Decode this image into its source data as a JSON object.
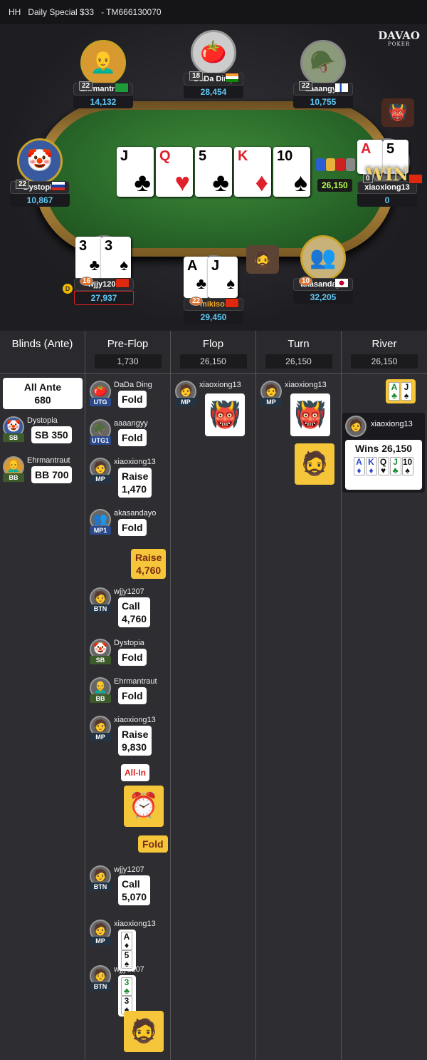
{
  "header": {
    "mode": "HH",
    "tournament": "Daily Special $33",
    "id": "- TM666130070"
  },
  "logo": {
    "name": "DAVAO",
    "sub": "POKER"
  },
  "seats": [
    {
      "key": "ehrmantraut",
      "name": "Ehrmantraut",
      "stack": "14,132",
      "level": "22",
      "flag": "brazil"
    },
    {
      "key": "dada",
      "name": "DaDa Ding",
      "stack": "28,454",
      "level": "18",
      "flag": "india"
    },
    {
      "key": "aaaangyy",
      "name": "aaaangyy",
      "stack": "10,755",
      "level": "22",
      "flag": "finland"
    },
    {
      "key": "dystopia",
      "name": "Dystopia",
      "stack": "10,867",
      "level": "22",
      "flag": "russia"
    },
    {
      "key": "xiaoxiong",
      "name": "xiaoxiong13",
      "stack": "0",
      "level": "0",
      "flag": "china"
    },
    {
      "key": "wjjy",
      "name": "wjjy1207",
      "stack": "27,937",
      "level": "16",
      "flag": "china"
    },
    {
      "key": "mikisol",
      "name": "mikisol",
      "stack": "29,450",
      "level": "22",
      "flag": "hongkong"
    },
    {
      "key": "akasandayo",
      "name": "akasandayo",
      "stack": "32,205",
      "level": "10",
      "flag": "japan"
    }
  ],
  "board": [
    {
      "rank": "J",
      "suit": "♣",
      "color": "black"
    },
    {
      "rank": "Q",
      "suit": "♥",
      "color": "red"
    },
    {
      "rank": "5",
      "suit": "♣",
      "color": "black"
    },
    {
      "rank": "K",
      "suit": "♦",
      "color": "red"
    },
    {
      "rank": "10",
      "suit": "♠",
      "color": "black"
    }
  ],
  "pot": "26,150",
  "win_label": "WIN",
  "dealer_button": "D",
  "hole_cards": {
    "xiaoxiong": [
      {
        "rank": "A",
        "suit": "♠"
      },
      {
        "rank": "5",
        "suit": "♠"
      }
    ],
    "wjjy": [
      {
        "rank": "3",
        "suit": "♣"
      },
      {
        "rank": "3",
        "suit": "♠"
      }
    ],
    "mikisol": [
      {
        "rank": "A",
        "suit": "♣"
      },
      {
        "rank": "J",
        "suit": "♠"
      }
    ]
  },
  "columns": [
    {
      "title": "Blinds (Ante)",
      "pot": ""
    },
    {
      "title": "Pre-Flop",
      "pot": "1,730"
    },
    {
      "title": "Flop",
      "pot": "26,150"
    },
    {
      "title": "Turn",
      "pot": "26,150"
    },
    {
      "title": "River",
      "pot": "26,150"
    }
  ],
  "blinds": {
    "ante_label": "All Ante",
    "ante_value": "680",
    "sb": {
      "name": "Dystopia",
      "pos": "SB",
      "action": "SB",
      "amount": "350"
    },
    "bb": {
      "name": "Ehrmantraut",
      "pos": "BB",
      "action": "BB",
      "amount": "700"
    }
  },
  "preflop": [
    {
      "name": "DaDa Ding",
      "pos": "UTG",
      "action": "Fold",
      "amount": ""
    },
    {
      "name": "aaaangyy",
      "pos": "UTG1",
      "action": "Fold",
      "amount": ""
    },
    {
      "name": "xiaoxiong13",
      "pos": "MP",
      "action": "Raise",
      "amount": "1,470"
    },
    {
      "name": "akasandayo",
      "pos": "MP1",
      "action": "Fold",
      "amount": ""
    },
    {
      "hero_action": "Raise",
      "hero_amount": "4,760"
    },
    {
      "name": "wjjy1207",
      "pos": "BTN",
      "action": "Call",
      "amount": "4,760"
    },
    {
      "name": "Dystopia",
      "pos": "SB",
      "action": "Fold",
      "amount": ""
    },
    {
      "name": "Ehrmantraut",
      "pos": "BB",
      "action": "Fold",
      "amount": ""
    },
    {
      "name": "xiaoxiong13",
      "pos": "MP",
      "action": "Raise",
      "amount": "9,830"
    },
    {
      "allin": "All-In"
    },
    {
      "hero_fold": "Fold"
    },
    {
      "name": "wjjy1207",
      "pos": "BTN",
      "action": "Call",
      "amount": "5,070"
    },
    {
      "name": "xiaoxiong13",
      "pos": "MP",
      "cards": [
        {
          "rank": "A",
          "suit": "♦"
        },
        {
          "rank": "5",
          "suit": "♠"
        }
      ]
    },
    {
      "name": "wjjy1207",
      "pos": "BTN",
      "cards": [
        {
          "rank": "3",
          "suit": "♣"
        },
        {
          "rank": "3",
          "suit": "♠"
        }
      ]
    }
  ],
  "flop": {
    "name": "xiaoxiong13",
    "pos": "MP"
  },
  "turn": {
    "name": "xiaoxiong13",
    "pos": "MP"
  },
  "river": {
    "board": [
      {
        "rank": "A",
        "suit": "♣"
      },
      {
        "rank": "J",
        "suit": "♠"
      }
    ],
    "winner": "xiaoxiong13",
    "wins_label": "Wins 26,150",
    "hand": [
      {
        "rank": "A",
        "suit": "♦"
      },
      {
        "rank": "K",
        "suit": "♦"
      },
      {
        "rank": "Q",
        "suit": "♥"
      },
      {
        "rank": "J",
        "suit": "♣"
      },
      {
        "rank": "10",
        "suit": "♠"
      }
    ]
  },
  "colors": {
    "stack": "#5fc8f5",
    "pot": "#b6ff4a",
    "highlight": "#f5c53a",
    "felt": "#2a6a2a"
  }
}
